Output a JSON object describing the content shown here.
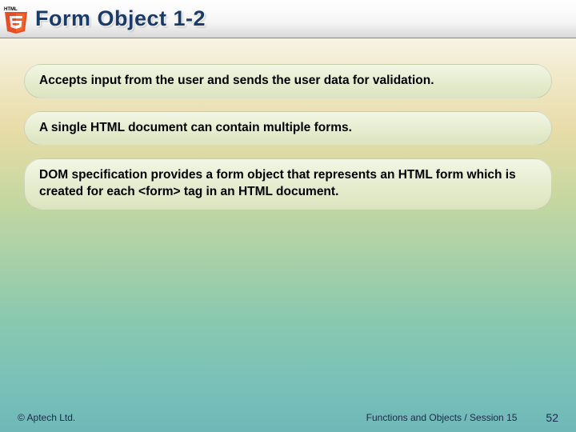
{
  "header": {
    "logo_label": "HTML5",
    "title": "Form Object 1-2"
  },
  "bullets": [
    "Accepts input from the user and sends the user data for validation.",
    "A single HTML document can contain multiple forms.",
    "DOM specification provides a form object that represents an HTML form which is created for each <form> tag in an HTML document."
  ],
  "footer": {
    "copyright": "© Aptech Ltd.",
    "session": "Functions and Objects / Session 15",
    "page": "52"
  }
}
